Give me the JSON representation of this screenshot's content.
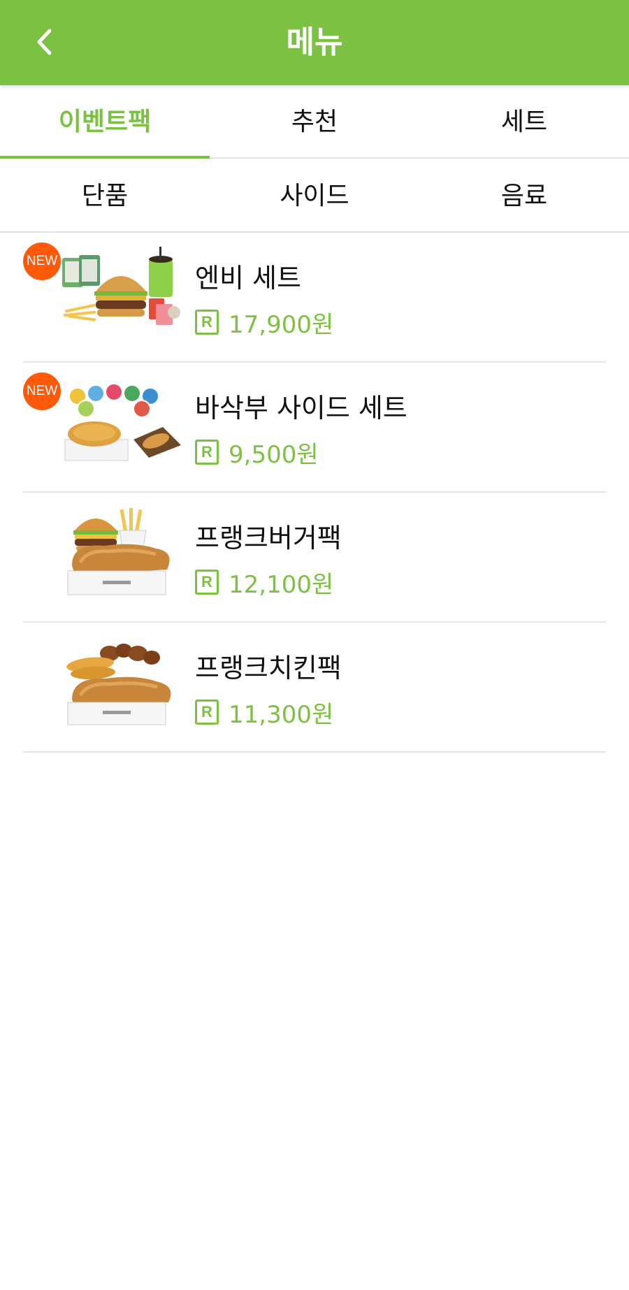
{
  "header": {
    "title": "메뉴",
    "back_icon": "chevron-left-icon"
  },
  "tabs": [
    {
      "label": "이벤트팩",
      "active": true
    },
    {
      "label": "추천",
      "active": false
    },
    {
      "label": "세트",
      "active": false
    },
    {
      "label": "단품",
      "active": false
    },
    {
      "label": "사이드",
      "active": false
    },
    {
      "label": "음료",
      "active": false
    }
  ],
  "menu": {
    "price_icon": "R",
    "items": [
      {
        "name": "엔비 세트",
        "price": "17,900원",
        "badge": "NEW"
      },
      {
        "name": "바삭부 사이드 세트",
        "price": "9,500원",
        "badge": "NEW"
      },
      {
        "name": "프랭크버거팩",
        "price": "12,100원",
        "badge": ""
      },
      {
        "name": "프랭크치킨팩",
        "price": "11,300원",
        "badge": ""
      }
    ]
  },
  "colors": {
    "accent": "#7dc142",
    "badge": "#ff5a0a",
    "divider": "#e6e6e6"
  }
}
